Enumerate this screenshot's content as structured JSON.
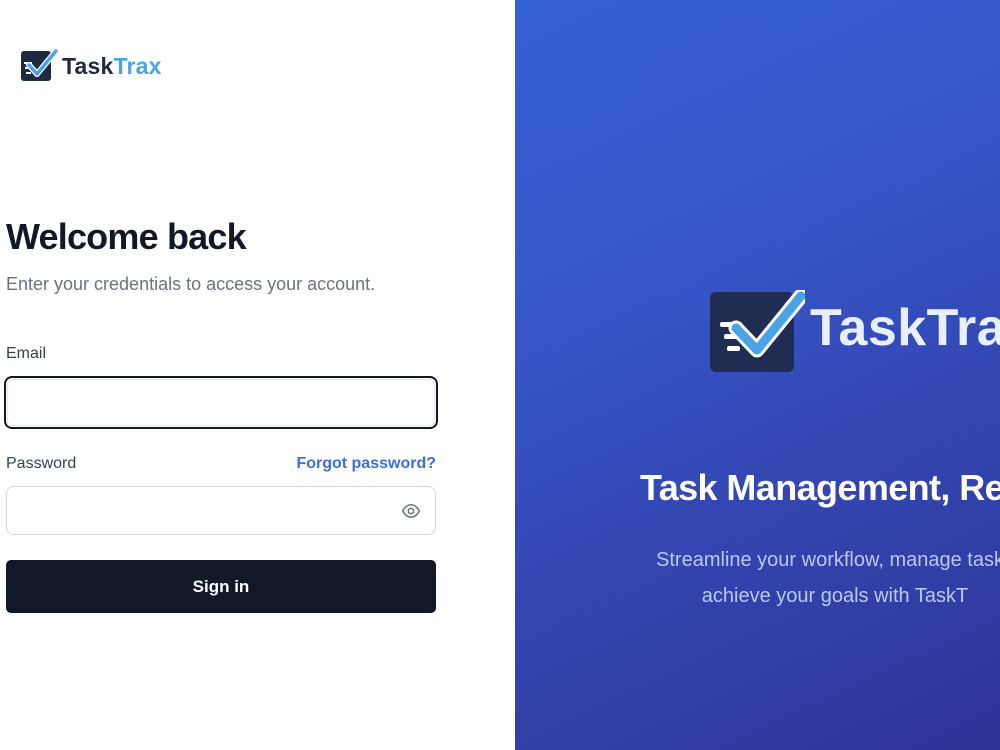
{
  "brand": {
    "name_part1": "Task",
    "name_part2": "Trax",
    "colors": {
      "dark": "#1e2a44",
      "accent": "#4aa3e6"
    }
  },
  "login": {
    "title": "Welcome back",
    "subtitle": "Enter your credentials to access your account.",
    "email_label": "Email",
    "email_value": "",
    "password_label": "Password",
    "password_value": "",
    "forgot_link": "Forgot password?",
    "submit_label": "Sign in",
    "password_toggle_icon": "eye-icon"
  },
  "hero": {
    "brand_name": "TaskTrax",
    "title": "Task Management, Rec",
    "text_line1": "Streamline your workflow, manage tasks",
    "text_line2": "achieve your goals with TaskT",
    "colors": {
      "panel_start": "#3560d4",
      "panel_end": "#2e3596",
      "button": "#111827",
      "link": "#3b6fd8"
    }
  }
}
